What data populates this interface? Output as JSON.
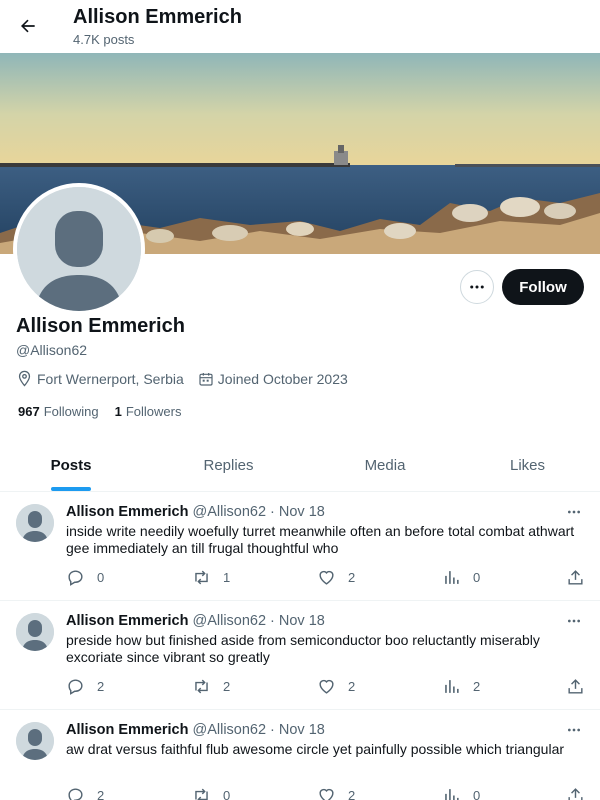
{
  "header": {
    "title": "Allison Emmerich",
    "post_count": "4.7K posts"
  },
  "profile": {
    "name": "Allison Emmerich",
    "handle": "@Allison62",
    "location": "Fort Wernerport, Serbia",
    "joined": "Joined October 2023",
    "following_count": "967",
    "following_label": "Following",
    "followers_count": "1",
    "followers_label": "Followers",
    "follow_button": "Follow"
  },
  "tabs": [
    {
      "label": "Posts",
      "active": true
    },
    {
      "label": "Replies",
      "active": false
    },
    {
      "label": "Media",
      "active": false
    },
    {
      "label": "Likes",
      "active": false
    }
  ],
  "posts": [
    {
      "author": "Allison Emmerich",
      "handle": "@Allison62",
      "sep": "·",
      "date": "Nov 18",
      "text": "inside write needily woefully turret meanwhile often an before total combat athwart gee immediately an till frugal thoughtful who",
      "replies": "0",
      "reposts": "1",
      "likes": "2",
      "views": "0"
    },
    {
      "author": "Allison Emmerich",
      "handle": "@Allison62",
      "sep": "·",
      "date": "Nov 18",
      "text": "preside how but finished aside from semiconductor boo reluctantly miserably excoriate since vibrant so greatly",
      "replies": "2",
      "reposts": "2",
      "likes": "2",
      "views": "2"
    },
    {
      "author": "Allison Emmerich",
      "handle": "@Allison62",
      "sep": "·",
      "date": "Nov 18",
      "text": "aw drat versus faithful flub awesome circle yet painfully possible which triangular",
      "replies": "2",
      "reposts": "0",
      "likes": "2",
      "views": "0"
    }
  ],
  "icons": {
    "back": "arrow-left-icon",
    "more": "more-horizontal-icon",
    "location": "location-pin-icon",
    "calendar": "calendar-icon",
    "reply": "reply-icon",
    "repost": "repost-icon",
    "like": "heart-icon",
    "views": "views-icon",
    "share": "share-icon"
  },
  "colors": {
    "accent": "#1d9bf0",
    "text": "#0f1419",
    "muted": "#536471",
    "follow_button_bg": "#0f1419"
  }
}
